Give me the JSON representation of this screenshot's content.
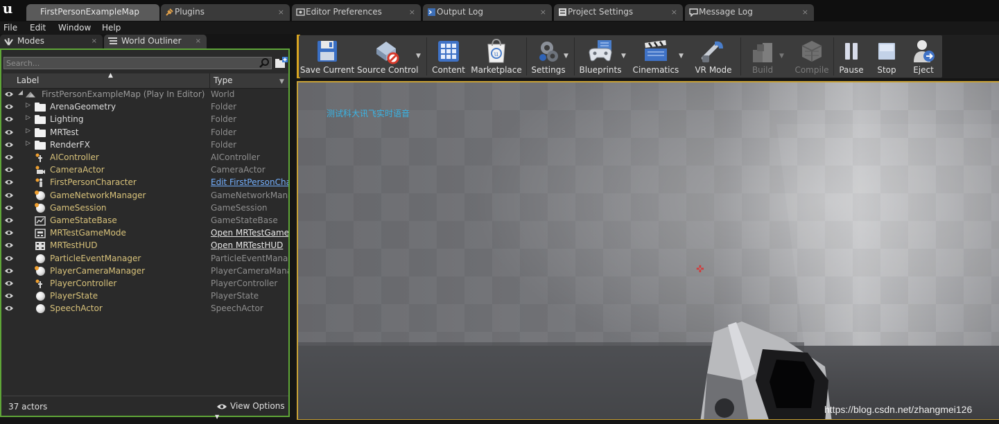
{
  "tabs": [
    {
      "label": "FirstPersonExampleMap",
      "active": true,
      "icon": "map-tab-icon"
    },
    {
      "label": "Plugins",
      "icon": "plug-icon"
    },
    {
      "label": "Editor Preferences",
      "icon": "preferences-icon"
    },
    {
      "label": "Output Log",
      "icon": "log-icon"
    },
    {
      "label": "Project Settings",
      "icon": "settings-tab-icon"
    },
    {
      "label": "Message Log",
      "icon": "message-icon"
    }
  ],
  "tab_close_glyph": "×",
  "menu": [
    "File",
    "Edit",
    "Window",
    "Help"
  ],
  "left_tabs": {
    "modes": "Modes",
    "outliner": "World Outliner"
  },
  "outliner": {
    "search_placeholder": "Search...",
    "header_label": "Label",
    "header_type": "Type",
    "rows": [
      {
        "label": "FirstPersonExampleMap (Play In Editor)",
        "type": "World",
        "kind": "root"
      },
      {
        "label": "ArenaGeometry",
        "type": "Folder",
        "kind": "folder"
      },
      {
        "label": "Lighting",
        "type": "Folder",
        "kind": "folder"
      },
      {
        "label": "MRTest",
        "type": "Folder",
        "kind": "folder"
      },
      {
        "label": "RenderFX",
        "type": "Folder",
        "kind": "folder"
      },
      {
        "label": "AIController",
        "type": "AIController",
        "kind": "actor",
        "icon": "controller-icon"
      },
      {
        "label": "CameraActor",
        "type": "CameraActor",
        "kind": "actor",
        "icon": "camera-icon"
      },
      {
        "label": "FirstPersonCharacter",
        "type": "Edit FirstPersonCharacter",
        "kind": "actor",
        "icon": "character-icon",
        "type_style": "link-blue"
      },
      {
        "label": "GameNetworkManager",
        "type": "GameNetworkManager",
        "kind": "actor",
        "icon": "sphere-icon"
      },
      {
        "label": "GameSession",
        "type": "GameSession",
        "kind": "actor",
        "icon": "sphere-icon"
      },
      {
        "label": "GameStateBase",
        "type": "GameStateBase",
        "kind": "actor",
        "icon": "gamestate-icon"
      },
      {
        "label": "MRTestGameMode",
        "type": "Open MRTestGameMode",
        "kind": "actor",
        "icon": "gamemode-icon",
        "type_style": "link-white"
      },
      {
        "label": "MRTestHUD",
        "type": "Open MRTestHUD",
        "kind": "actor",
        "icon": "hud-icon",
        "type_style": "link-white"
      },
      {
        "label": "ParticleEventManager",
        "type": "ParticleEventManager",
        "kind": "actor",
        "icon": "sphere-icon"
      },
      {
        "label": "PlayerCameraManager",
        "type": "PlayerCameraManager",
        "kind": "actor",
        "icon": "sphere-icon"
      },
      {
        "label": "PlayerController",
        "type": "PlayerController",
        "kind": "actor",
        "icon": "controller-icon"
      },
      {
        "label": "PlayerState",
        "type": "PlayerState",
        "kind": "actor",
        "icon": "sphere-icon"
      },
      {
        "label": "SpeechActor",
        "type": "SpeechActor",
        "kind": "actor",
        "icon": "sphere-icon"
      }
    ],
    "actor_count": "37 actors",
    "view_options": "View Options"
  },
  "toolbar": [
    {
      "label": "Save Current",
      "icon": "save-icon"
    },
    {
      "label": "Source Control",
      "icon": "source-control-icon",
      "dropdown": true
    },
    {
      "label": "Content",
      "icon": "content-icon"
    },
    {
      "label": "Marketplace",
      "icon": "marketplace-icon"
    },
    {
      "label": "Settings",
      "icon": "settings-icon",
      "dropdown": true
    },
    {
      "label": "Blueprints",
      "icon": "blueprints-icon",
      "dropdown": true
    },
    {
      "label": "Cinematics",
      "icon": "cinematics-icon",
      "dropdown": true
    },
    {
      "label": "VR Mode",
      "icon": "vr-mode-icon"
    },
    {
      "label": "Build",
      "icon": "build-icon",
      "dropdown": true,
      "disabled": true
    },
    {
      "label": "Compile",
      "icon": "compile-icon",
      "disabled": true
    },
    {
      "label": "Pause",
      "icon": "pause-icon"
    },
    {
      "label": "Stop",
      "icon": "stop-icon"
    },
    {
      "label": "Eject",
      "icon": "eject-icon"
    }
  ],
  "viewport": {
    "debug_text": "测试科大讯飞实时语音",
    "crosshair": "✜",
    "watermark": "https://blog.csdn.net/zhangmei126"
  },
  "colors": {
    "outliner_border": "#5fa638",
    "viewport_border": "#c9a236",
    "debug_text": "#39b5e6",
    "actor_label": "#d8c27a"
  }
}
